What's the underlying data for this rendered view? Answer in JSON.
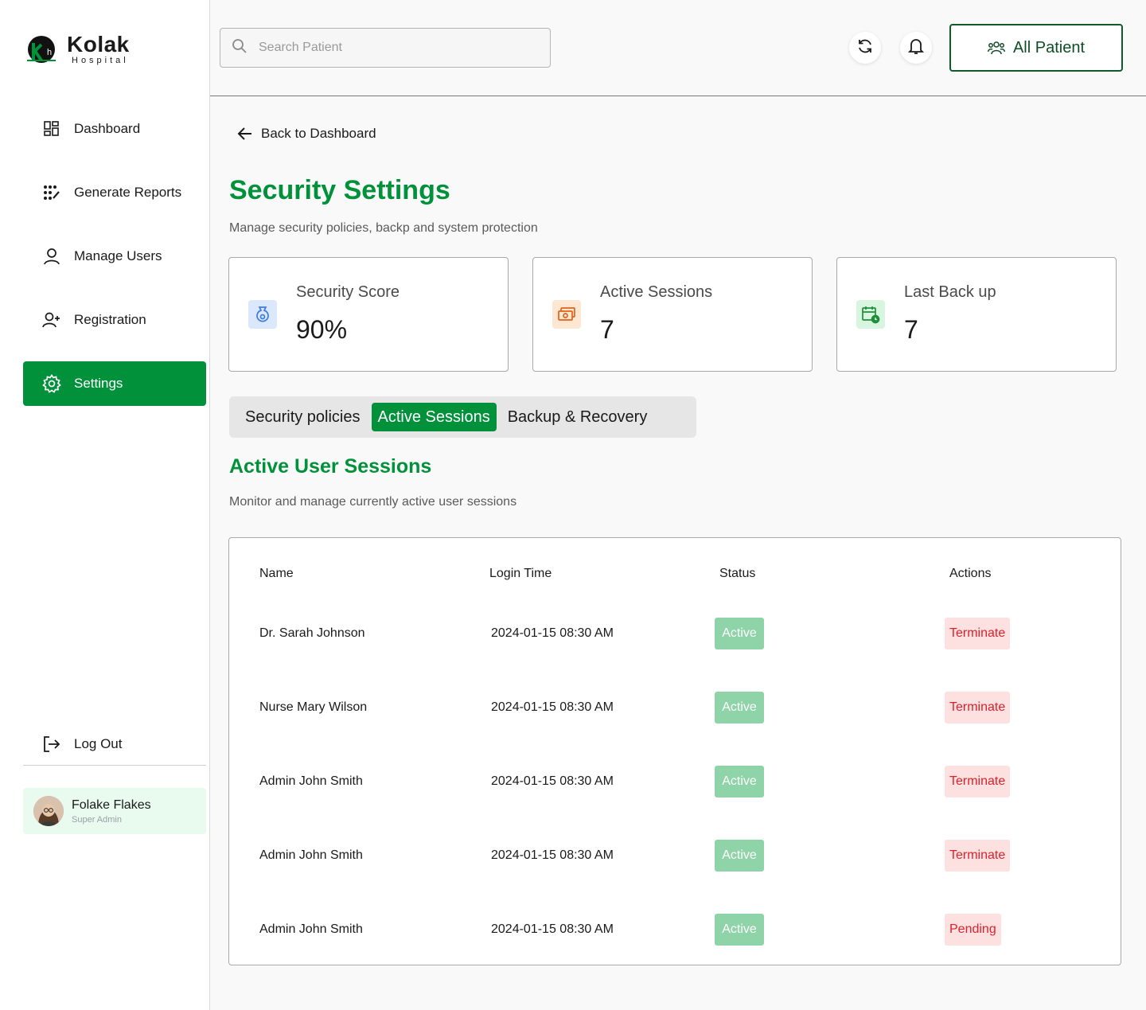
{
  "brand": {
    "name": "Kolak",
    "subtitle": "Hospital",
    "logo_letters": "Kh"
  },
  "sidebar": {
    "items": [
      {
        "label": "Dashboard",
        "icon": "dashboard-grid-icon"
      },
      {
        "label": "Generate Reports",
        "icon": "reports-dots-icon"
      },
      {
        "label": "Manage Users",
        "icon": "user-icon"
      },
      {
        "label": "Registration",
        "icon": "user-add-icon"
      },
      {
        "label": "Settings",
        "icon": "gear-icon",
        "active": true
      }
    ],
    "logout_label": "Log Out",
    "profile": {
      "name": "Folake Flakes",
      "role": "Super Admin"
    }
  },
  "topbar": {
    "search_placeholder": "Search Patient",
    "all_patient_label": "All Patient"
  },
  "main": {
    "back_label": "Back to Dashboard",
    "title": "Security Settings",
    "subtitle": "Manage security policies, backp and system protection",
    "cards": [
      {
        "label": "Security Score",
        "value": "90%",
        "icon": "shield-bag-icon",
        "accent": "#3d7be0"
      },
      {
        "label": "Active Sessions",
        "value": "7",
        "icon": "money-sessions-icon",
        "accent": "#e0621a"
      },
      {
        "label": "Last Back up",
        "value": "7",
        "icon": "calendar-clock-icon",
        "accent": "#1f8f3a"
      }
    ],
    "tabs": [
      {
        "label": "Security policies"
      },
      {
        "label": "Active Sessions",
        "active": true
      },
      {
        "label": "Backup & Recovery"
      }
    ],
    "section_title": "Active User Sessions",
    "section_subtitle": "Monitor and manage currently active user sessions",
    "table": {
      "headers": [
        "Name",
        "Login Time",
        "Status",
        "Actions"
      ],
      "rows": [
        {
          "name": "Dr. Sarah Johnson",
          "login_time": "2024-01-15 08:30 AM",
          "status": "Active",
          "action": "Terminate"
        },
        {
          "name": "Nurse Mary Wilson",
          "login_time": "2024-01-15 08:30 AM",
          "status": "Active",
          "action": "Terminate"
        },
        {
          "name": "Admin John Smith",
          "login_time": "2024-01-15 08:30 AM",
          "status": "Active",
          "action": "Terminate"
        },
        {
          "name": "Admin John Smith",
          "login_time": "2024-01-15 08:30 AM",
          "status": "Active",
          "action": "Terminate"
        },
        {
          "name": "Admin John Smith",
          "login_time": "2024-01-15 08:30 AM",
          "status": "Active",
          "action": "Pending"
        }
      ]
    }
  },
  "colors": {
    "primary": "#00913a",
    "danger": "#e0202a",
    "danger_bg": "#fde0e0",
    "active_badge": "#8fd3a8"
  }
}
